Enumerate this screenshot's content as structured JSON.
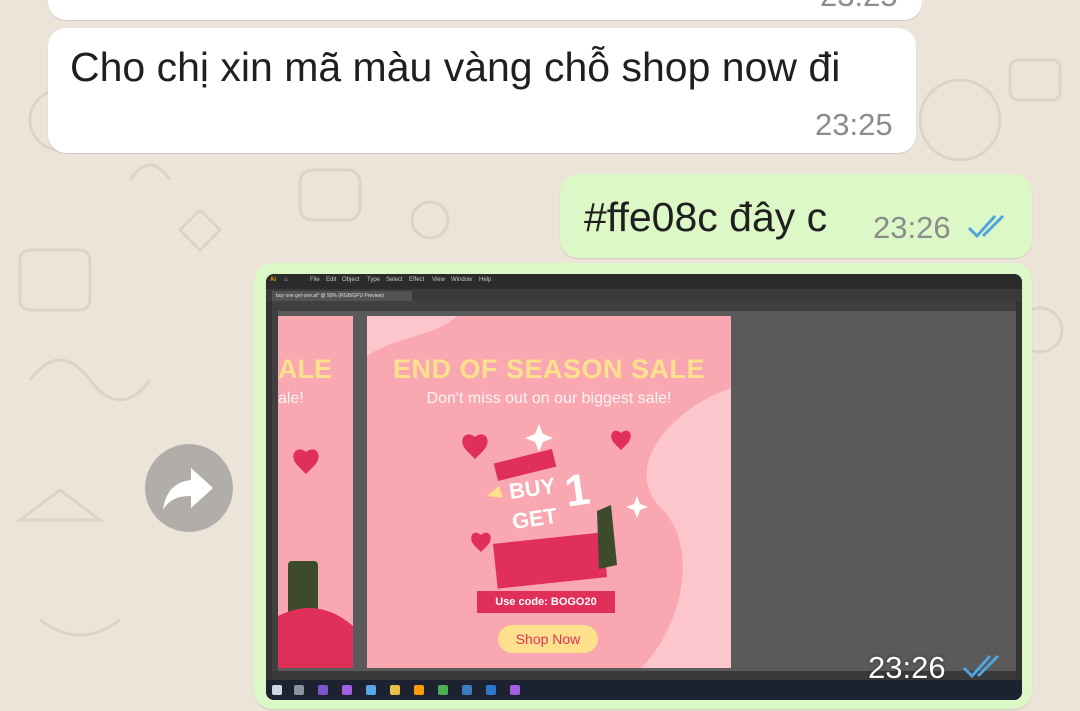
{
  "messages": [
    {
      "text": "Cho chị xin mã màu vàng chỗ shop now đi",
      "time": "23:25"
    },
    {
      "text": "#ffe08c đây c",
      "time": "23:26"
    }
  ],
  "image_message": {
    "time": "23:26",
    "forward_icon": "share-forward-icon",
    "screenshot": {
      "app": "Adobe Illustrator",
      "menu": [
        "File",
        "Edit",
        "Object",
        "Type",
        "Select",
        "Effect",
        "View",
        "Window",
        "Help"
      ],
      "document_tab": "buy one get one.ai* @ 90% (RGB/GPU Preview)",
      "artboard": {
        "title": "END OF SEASON SALE",
        "subtitle": "Don't miss out on our biggest sale!",
        "buy": "BUY",
        "get": "GET",
        "one": "1",
        "code": "Use code: BOGO20",
        "shop_button": "Shop Now"
      },
      "left_artboard": {
        "title": "ALE",
        "subtitle": "ale!"
      },
      "colors": {
        "yellow": "#ffe08c",
        "pink": "#f9a7b0",
        "accent": "#e0305a"
      }
    }
  },
  "read_receipt_color": "#4fa3e0"
}
